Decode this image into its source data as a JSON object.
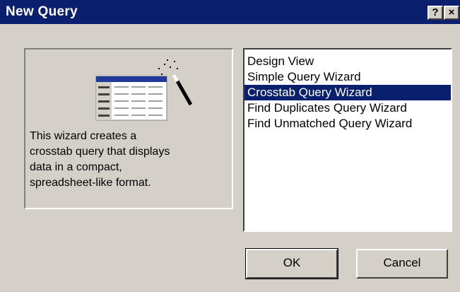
{
  "dialog": {
    "title": "New Query",
    "help_glyph": "?",
    "close_glyph": "×"
  },
  "illustration": {
    "icon": "crosstab-wizard-icon",
    "grid_cell_text": "xxx"
  },
  "description": "This wizard creates a\ncrosstab query that displays\ndata in a compact,\nspreadsheet-like format.",
  "list": {
    "items": [
      "Design View",
      "Simple Query Wizard",
      "Crosstab Query Wizard",
      "Find Duplicates Query Wizard",
      "Find Unmatched Query Wizard"
    ],
    "selected": "Crosstab Query Wizard"
  },
  "buttons": {
    "ok": "OK",
    "cancel": "Cancel"
  },
  "colors": {
    "title_bar": "#0a1f6e",
    "selection": "#0a1f6e",
    "face": "#d4d0c8"
  }
}
